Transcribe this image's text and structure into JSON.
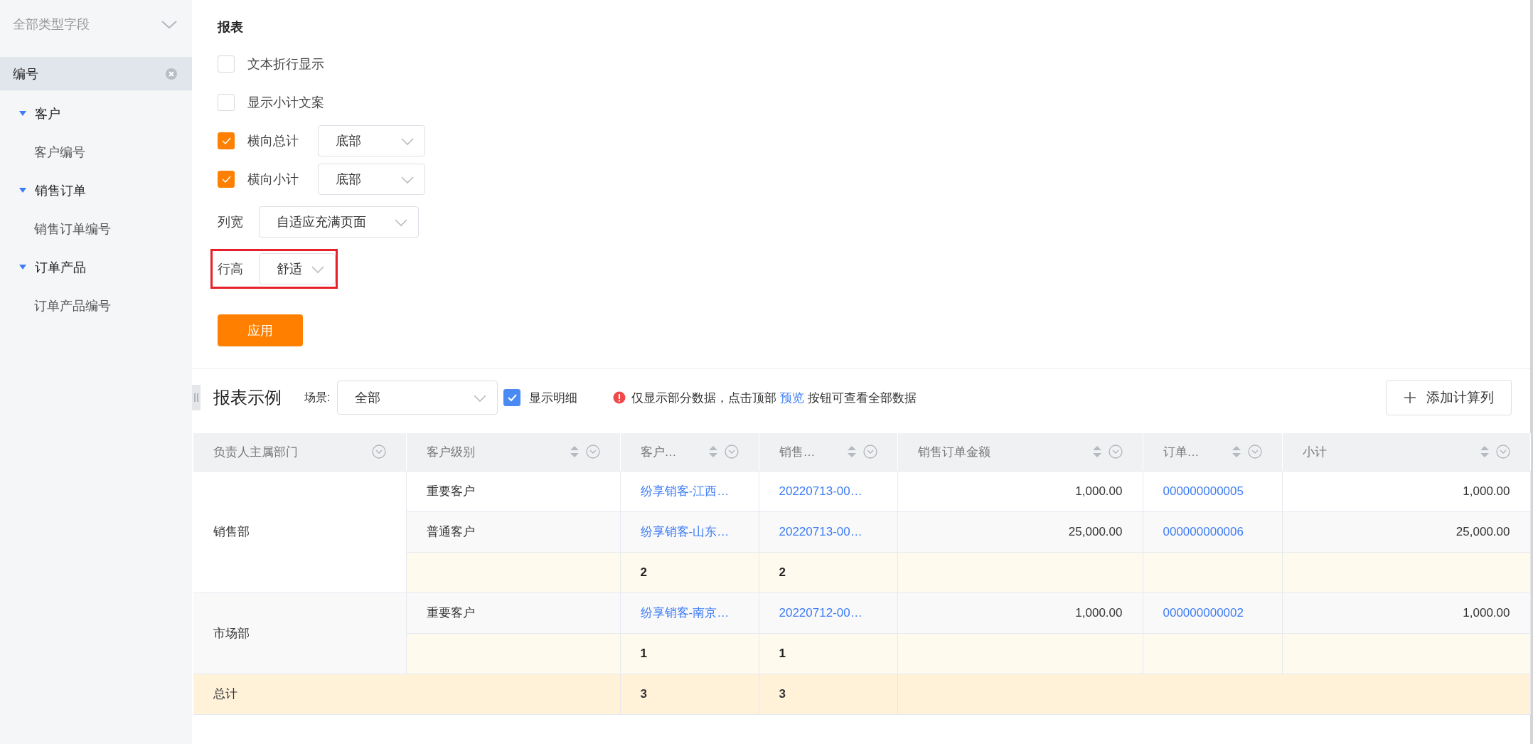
{
  "sidebar": {
    "filter": {
      "value": "全部类型字段"
    },
    "search_tag": {
      "label": "编号"
    },
    "groups": [
      {
        "label": "客户",
        "expanded": true,
        "children": [
          {
            "label": "客户编号"
          }
        ]
      },
      {
        "label": "销售订单",
        "expanded": true,
        "children": [
          {
            "label": "销售订单编号"
          }
        ]
      },
      {
        "label": "订单产品",
        "expanded": true,
        "children": [
          {
            "label": "订单产品编号"
          }
        ]
      }
    ]
  },
  "settings": {
    "title": "报表",
    "options": [
      {
        "kind": "checkbox",
        "label": "文本折行显示",
        "checked": false
      },
      {
        "kind": "checkbox",
        "label": "显示小计文案",
        "checked": false
      },
      {
        "kind": "checkbox",
        "label": "横向总计",
        "checked": true,
        "value": "底部"
      },
      {
        "kind": "checkbox",
        "label": "横向小计",
        "checked": true,
        "value": "底部"
      },
      {
        "kind": "select",
        "label": "列宽",
        "value": "自适应充满页面",
        "highlighted": false
      },
      {
        "kind": "select",
        "label": "行高",
        "value": "舒适",
        "highlighted": true
      }
    ],
    "apply_button": "应用"
  },
  "preview": {
    "title": "报表示例",
    "scene_label": "场景:",
    "scene_value": "全部",
    "show_detail": {
      "label": "显示明细",
      "checked": true
    },
    "notice": {
      "before": "仅显示部分数据，点击顶部 ",
      "link": "预览",
      "after": " 按钮可查看全部数据"
    },
    "add_button": "添加计算列"
  },
  "table": {
    "columns": [
      {
        "label": "负责人主属部门",
        "sortable": false
      },
      {
        "label": "客户级别",
        "sortable": true
      },
      {
        "label": "客户…",
        "sortable": true
      },
      {
        "label": "销售…",
        "sortable": true
      },
      {
        "label": "销售订单金额",
        "sortable": true
      },
      {
        "label": "订单…",
        "sortable": true
      },
      {
        "label": "小计",
        "sortable": true
      }
    ],
    "groups": [
      {
        "department": "销售部",
        "rows": [
          {
            "level": "重要客户",
            "customer": "纷享销客-江西…",
            "order": "20220713-00…",
            "amount": "1,000.00",
            "product_order": "000000000005",
            "subtotal": "1,000.00"
          },
          {
            "level": "普通客户",
            "customer": "纷享销客-山东…",
            "order": "20220713-00…",
            "amount": "25,000.00",
            "product_order": "000000000006",
            "subtotal": "25,000.00"
          }
        ],
        "subtotal": {
          "customer_count": "2",
          "order_count": "2"
        }
      },
      {
        "department": "市场部",
        "rows": [
          {
            "level": "重要客户",
            "customer": "纷享销客-南京…",
            "order": "20220712-00…",
            "amount": "1,000.00",
            "product_order": "000000000002",
            "subtotal": "1,000.00"
          }
        ],
        "subtotal": {
          "customer_count": "1",
          "order_count": "1"
        }
      }
    ],
    "total": {
      "label": "总计",
      "customer_count": "3",
      "order_count": "3"
    }
  }
}
